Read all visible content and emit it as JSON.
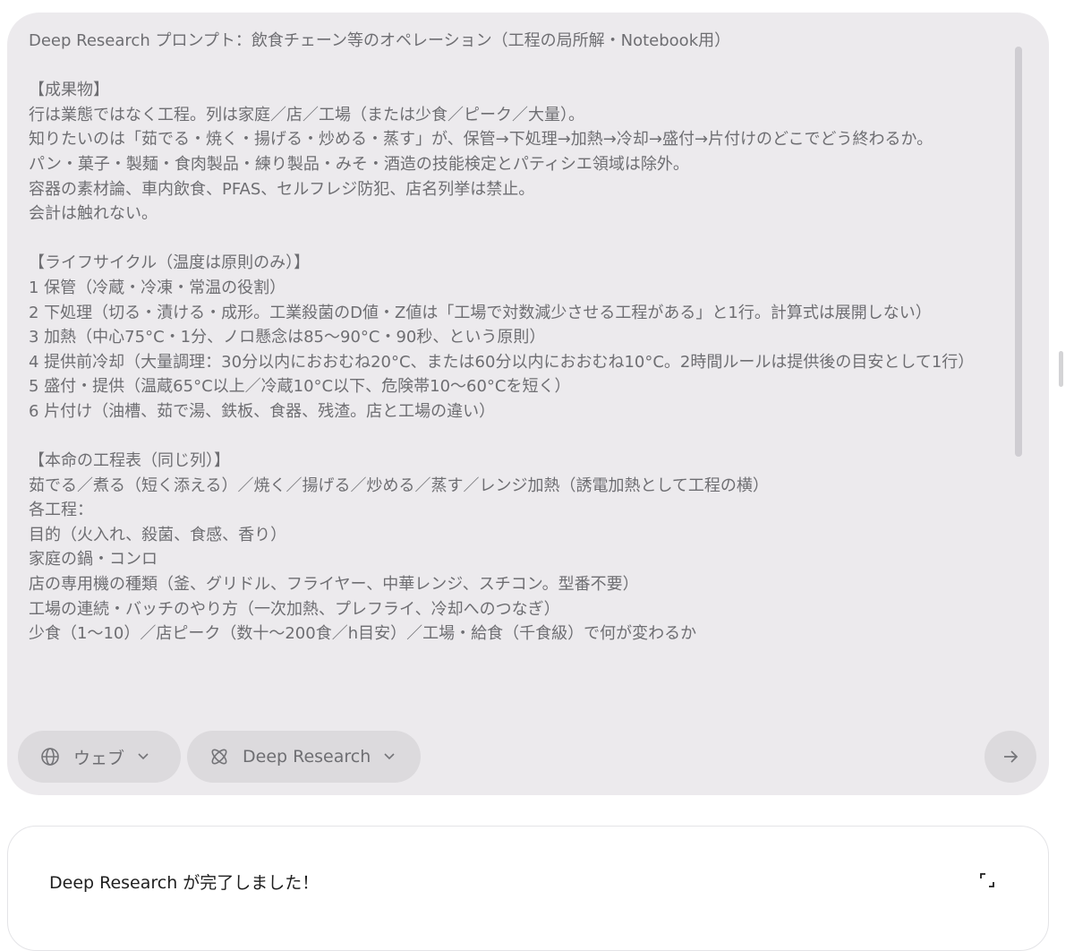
{
  "prompt": {
    "text": "Deep Research プロンプト：飲食チェーン等のオペレーション（工程の局所解・Notebook用）\n\n【成果物】\n行は業態ではなく工程。列は家庭／店／工場（または少食／ピーク／大量）。\n知りたいのは「茹でる・焼く・揚げる・炒める・蒸す」が、保管→下処理→加熱→冷却→盛付→片付けのどこでどう終わるか。\nパン・菓子・製麺・食肉製品・練り製品・みそ・酒造の技能検定とパティシエ領域は除外。\n容器の素材論、車内飲食、PFAS、セルフレジ防犯、店名列挙は禁止。\n会計は触れない。\n\n【ライフサイクル（温度は原則のみ）】\n1 保管（冷蔵・冷凍・常温の役割）\n2 下処理（切る・漬ける・成形。工業殺菌のD値・Z値は「工場で対数減少させる工程がある」と1行。計算式は展開しない）\n3 加熱（中心75°C・1分、ノロ懸念は85〜90°C・90秒、という原則）\n4 提供前冷却（大量調理：30分以内におおむね20°C、または60分以内におおむね10°C。2時間ルールは提供後の目安として1行）\n5 盛付・提供（温蔵65°C以上／冷蔵10°C以下、危険帯10〜60°Cを短く）\n6 片付け（油槽、茹で湯、鉄板、食器、残渣。店と工場の違い）\n\n【本命の工程表（同じ列）】\n茹でる／煮る（短く添える）／焼く／揚げる／炒める／蒸す／レンジ加熱（誘電加熱として工程の横）\n各工程：\n目的（火入れ、殺菌、食感、香り）\n家庭の鍋・コンロ\n店の専用機の種類（釜、グリドル、フライヤー、中華レンジ、スチコン。型番不要）\n工場の連続・バッチのやり方（一次加熱、プレフライ、冷却へのつなぎ）\n少食（1〜10）／店ピーク（数十〜200食／h目安）／工場・給食（千食級）で何が変わるか"
  },
  "toolbar": {
    "web_label": "ウェブ",
    "deep_research_label": "Deep Research",
    "web_icon": "globe-icon",
    "deep_research_icon": "deep-research-icon",
    "send_icon": "arrow-right-icon"
  },
  "status": {
    "message": "Deep Research が完了しました！",
    "expand_icon": "expand-icon"
  },
  "colors": {
    "composer_bg": "#eceaed",
    "chip_bg": "#dcdadd",
    "muted_text": "#6e6e72",
    "text": "#1f1f1f"
  }
}
